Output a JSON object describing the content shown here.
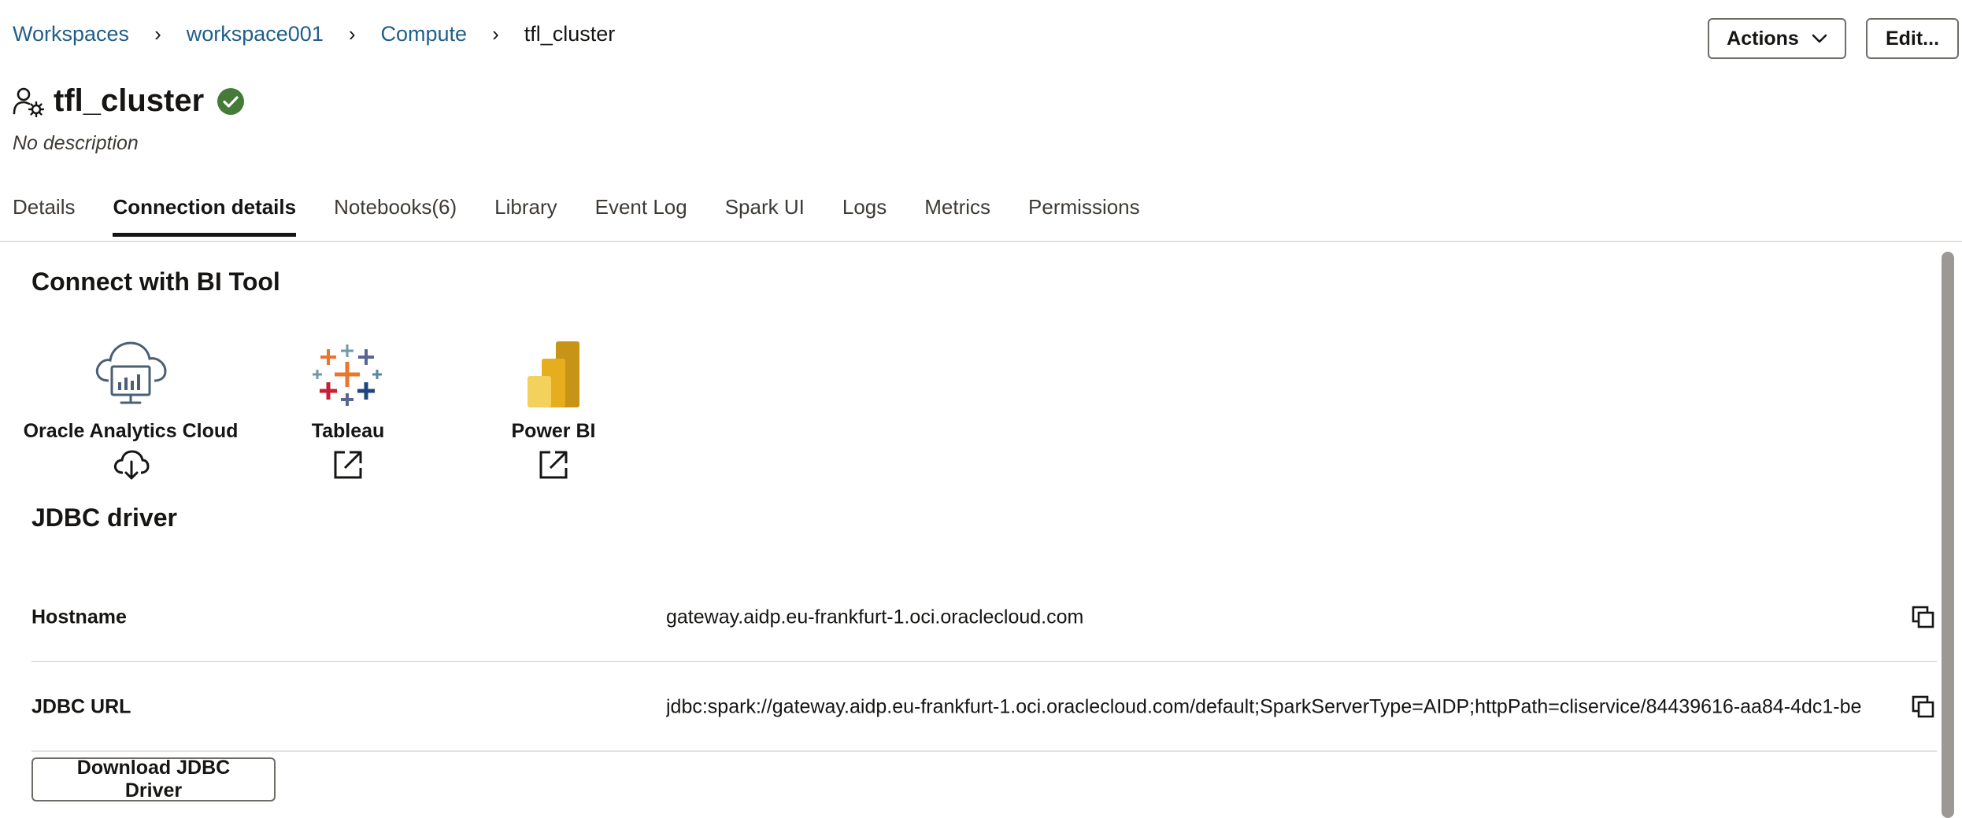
{
  "breadcrumb": {
    "items": [
      "Workspaces",
      "workspace001",
      "Compute"
    ],
    "current": "tfl_cluster"
  },
  "header": {
    "actions_label": "Actions",
    "edit_label": "Edit...",
    "title": "tfl_cluster",
    "description": "No description",
    "status": "active",
    "status_color": "#467a39"
  },
  "tabs": [
    {
      "label": "Details"
    },
    {
      "label": "Connection details",
      "active": true
    },
    {
      "label": "Notebooks(6)"
    },
    {
      "label": "Library"
    },
    {
      "label": "Event Log"
    },
    {
      "label": "Spark UI"
    },
    {
      "label": "Logs"
    },
    {
      "label": "Metrics"
    },
    {
      "label": "Permissions"
    }
  ],
  "connect_bi": {
    "heading": "Connect with BI Tool",
    "tools": [
      {
        "label": "Oracle Analytics Cloud",
        "action_icon": "cloud-download-icon"
      },
      {
        "label": "Tableau",
        "action_icon": "external-link-icon"
      },
      {
        "label": "Power BI",
        "action_icon": "external-link-icon"
      }
    ]
  },
  "jdbc": {
    "heading": "JDBC driver",
    "hostname_label": "Hostname",
    "hostname_value": "gateway.aidp.eu-frankfurt-1.oci.oraclecloud.com",
    "url_label": "JDBC URL",
    "url_value": "jdbc:spark://gateway.aidp.eu-frankfurt-1.oci.oraclecloud.com/default;SparkServerType=AIDP;httpPath=cliservice/84439616-aa84-4dc1-be",
    "download_label": "Download JDBC Driver"
  }
}
